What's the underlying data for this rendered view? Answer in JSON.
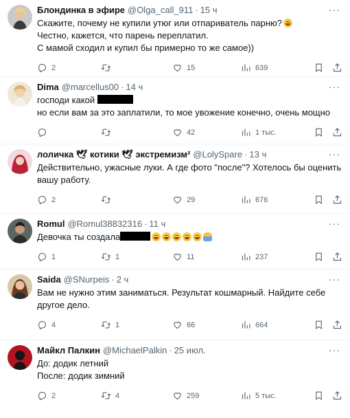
{
  "tweets": [
    {
      "name": "Блондинка в эфире",
      "handle": "@Olga_call_911",
      "sep": "·",
      "time": "15 ч",
      "more": "···",
      "lines": [
        "Скажите, почему не купили утюг или отпариватель парню?",
        "Честно, кажется, что парень переплатил.",
        "С мамой сходил и купил бы примерно то же самое))"
      ],
      "replies": "2",
      "retweets": "",
      "likes": "15",
      "views": "639"
    },
    {
      "name": "Dima",
      "handle": "@marcellus00",
      "sep": "·",
      "time": "14 ч",
      "more": "···",
      "lines": [
        "господи какой",
        "но если вам за это заплатили, то мое увожение конечно, очень мощно"
      ],
      "replies": "",
      "retweets": "",
      "likes": "42",
      "views": "1 тыс."
    },
    {
      "name": "лоличка 🕊 котики 🕊 экстремизм²",
      "handle": "@LolySpare",
      "sep": "·",
      "time": "13 ч",
      "more": "···",
      "lines": [
        "Действительно, ужасные луки. А где фото \"после\"? Хотелось бы оценить",
        "вашу работу."
      ],
      "replies": "2",
      "retweets": "",
      "likes": "29",
      "views": "676"
    },
    {
      "name": "Romul",
      "handle": "@Romul38832316",
      "sep": "·",
      "time": "11 ч",
      "more": "···",
      "lines": [
        "Девочка ты создала"
      ],
      "replies": "1",
      "retweets": "1",
      "likes": "11",
      "views": "237"
    },
    {
      "name": "Saida",
      "handle": "@SNurpeis",
      "sep": "·",
      "time": "2 ч",
      "more": "···",
      "lines": [
        "Вам не нужно этим заниматься. Результат кошмарный. Найдите себе",
        "другое дело."
      ],
      "replies": "4",
      "retweets": "1",
      "likes": "66",
      "views": "664"
    },
    {
      "name": "Майкл Палкин",
      "handle": "@MichaelPalkin",
      "sep": "·",
      "time": "25 июл.",
      "more": "···",
      "lines": [
        "До: додик летний",
        "После: додик зимний"
      ],
      "replies": "2",
      "retweets": "4",
      "likes": "259",
      "views": "5 тыс."
    }
  ],
  "icons": [
    "reply-icon",
    "retweet-icon",
    "like-icon",
    "views-icon",
    "bookmark-icon",
    "share-icon"
  ],
  "colors": {
    "text": "#0f1419",
    "muted": "#536471",
    "divider": "#eff3f4"
  }
}
